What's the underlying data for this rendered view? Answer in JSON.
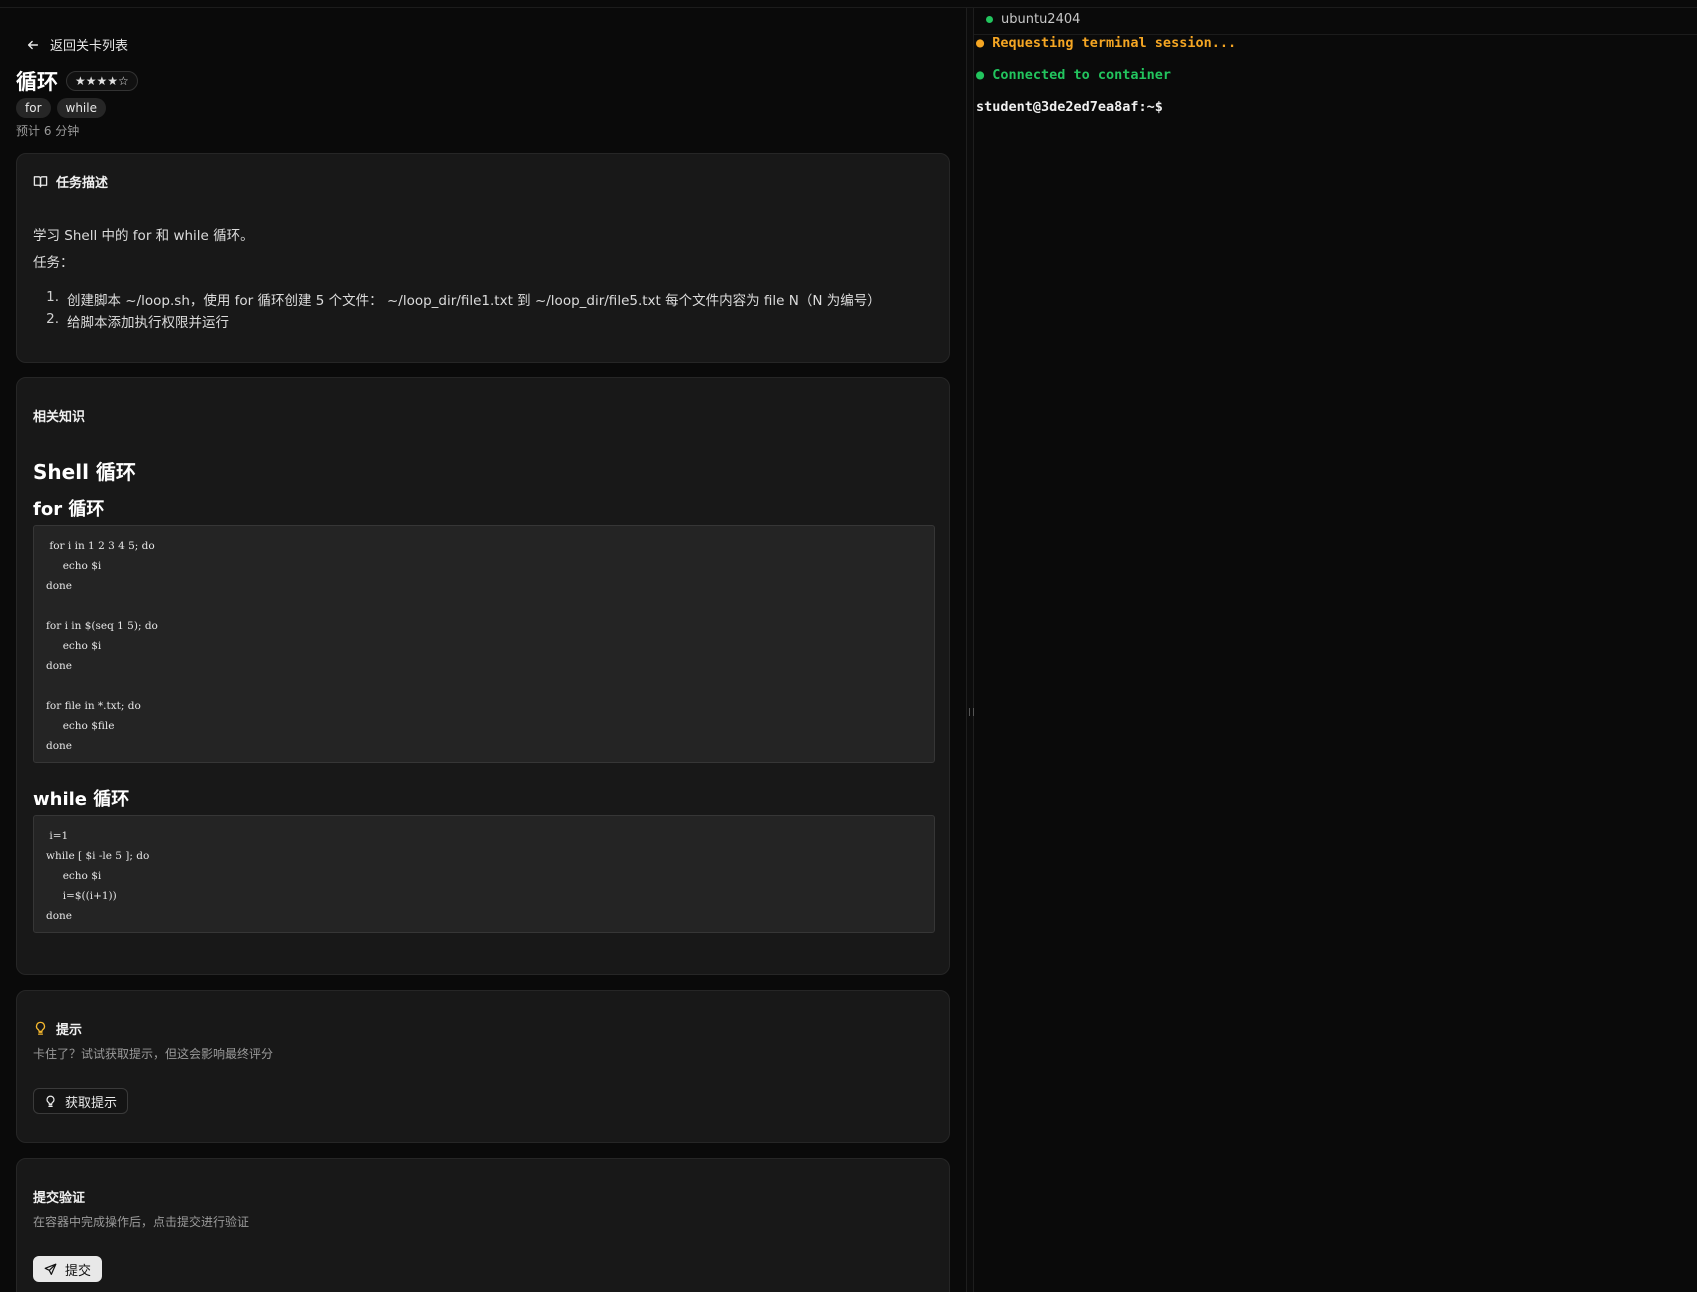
{
  "back": {
    "label": "返回关卡列表"
  },
  "level": {
    "title": "循环",
    "stars": "★★★★☆",
    "tags": [
      "for",
      "while"
    ],
    "estimate": "预计 6 分钟"
  },
  "task_card": {
    "heading": "任务描述",
    "intro": "学习 Shell 中的 for 和 while 循环。",
    "task_label": "任务：",
    "items": [
      {
        "num": "1.",
        "text": "创建脚本 ~/loop.sh，使用 for 循环创建 5 个文件： ~/loop_dir/file1.txt 到 ~/loop_dir/file5.txt 每个文件内容为 file N（N 为编号）"
      },
      {
        "num": "2.",
        "text": "给脚本添加执行权限并运行"
      }
    ]
  },
  "knowledge_card": {
    "heading": "相关知识",
    "h1": "Shell 循环",
    "for_heading": "for 循环",
    "for_code": " for i in 1 2 3 4 5; do\n     echo $i\ndone\n\nfor i in $(seq 1 5); do\n     echo $i\ndone\n\nfor file in *.txt; do\n     echo $file\ndone",
    "while_heading": "while 循环",
    "while_code": " i=1\nwhile [ $i -le 5 ]; do\n     echo $i\n     i=$((i+1))\ndone"
  },
  "hint_card": {
    "heading": "提示",
    "sub": "卡住了？试试获取提示，但这会影响最终评分",
    "button": "获取提示"
  },
  "submit_card": {
    "heading": "提交验证",
    "sub": "在容器中完成操作后，点击提交进行验证",
    "button": "提交"
  },
  "terminal": {
    "tab_label": "ubuntu2404",
    "line1": "● Requesting terminal session...",
    "line2": "● Connected to container",
    "prompt": "student@3de2ed7ea8af:~$"
  },
  "colors": {
    "warn": "#f5a623",
    "ok": "#22c55e",
    "hint_icon": "#f5b82e"
  }
}
